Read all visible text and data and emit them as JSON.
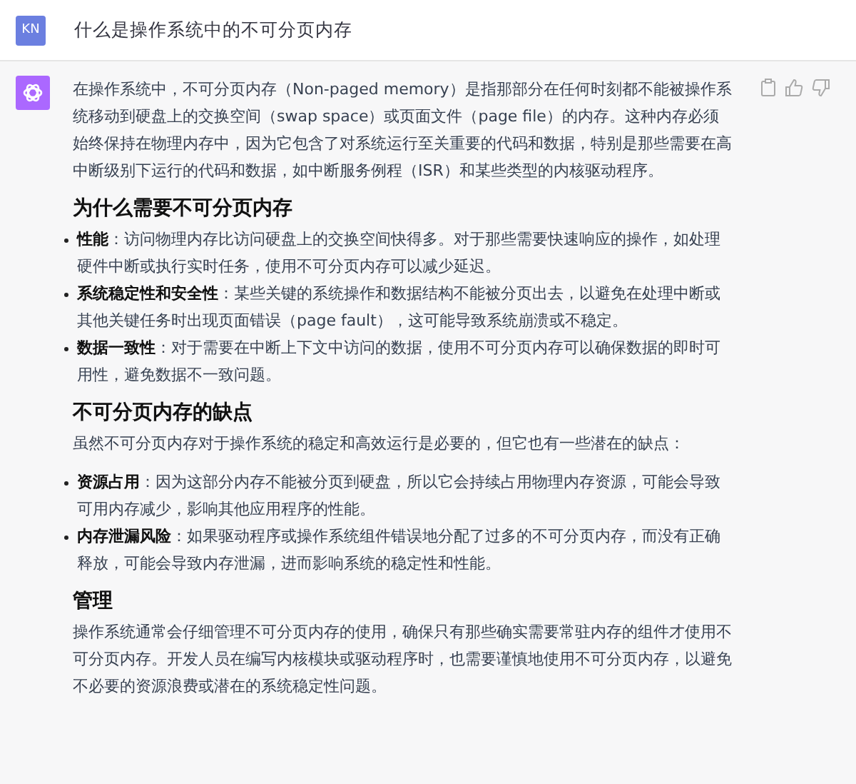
{
  "user_message": {
    "avatar": "KN",
    "text": "什么是操作系统中的不可分页内存"
  },
  "answer": {
    "blocks": [
      {
        "kind": "paragraph",
        "text": "在操作系统中，不可分页内存（Non-paged memory）是指那部分在任何时刻都不能被操作系统移动到硬盘上的交换空间（swap space）或页面文件（page file）的内存。这种内存必须始终保持在物理内存中，因为它包含了对系统运行至关重要的代码和数据，特别是那些需要在高中断级别下运行的代码和数据，如中断服务例程（ISR）和某些类型的内核驱动程序。"
      },
      {
        "kind": "heading",
        "text": "为什么需要不可分页内存"
      },
      {
        "kind": "bullets",
        "items": [
          "**性能**：访问物理内存比访问硬盘上的交换空间快得多。对于那些需要快速响应的操作，如处理硬件中断或执行实时任务，使用不可分页内存可以减少延迟。",
          "**系统稳定性和安全性**：某些关键的系统操作和数据结构不能被分页出去，以避免在处理中断或其他关键任务时出现页面错误（page fault），这可能导致系统崩溃或不稳定。",
          "**数据一致性**：对于需要在中断上下文中访问的数据，使用不可分页内存可以确保数据的即时可用性，避免数据不一致问题。"
        ]
      },
      {
        "kind": "heading",
        "text": "不可分页内存的缺点"
      },
      {
        "kind": "paragraph",
        "text": "虽然不可分页内存对于操作系统的稳定和高效运行是必要的，但它也有一些潜在的缺点："
      },
      {
        "kind": "bullets",
        "items": [
          "**资源占用**：因为这部分内存不能被分页到硬盘，所以它会持续占用物理内存资源，可能会导致可用内存减少，影响其他应用程序的性能。",
          "**内存泄漏风险**：如果驱动程序或操作系统组件错误地分配了过多的不可分页内存，而没有正确释放，可能会导致内存泄漏，进而影响系统的稳定性和性能。"
        ]
      },
      {
        "kind": "heading",
        "text": "管理"
      },
      {
        "kind": "paragraph",
        "text": "操作系统通常会仔细管理不可分页内存的使用，确保只有那些确实需要常驻内存的组件才使用不可分页内存。开发人员在编写内核模块或驱动程序时，也需要谨慎地使用不可分页内存，以避免不必要的资源浪费或潜在的系统稳定性问题。"
      }
    ]
  }
}
